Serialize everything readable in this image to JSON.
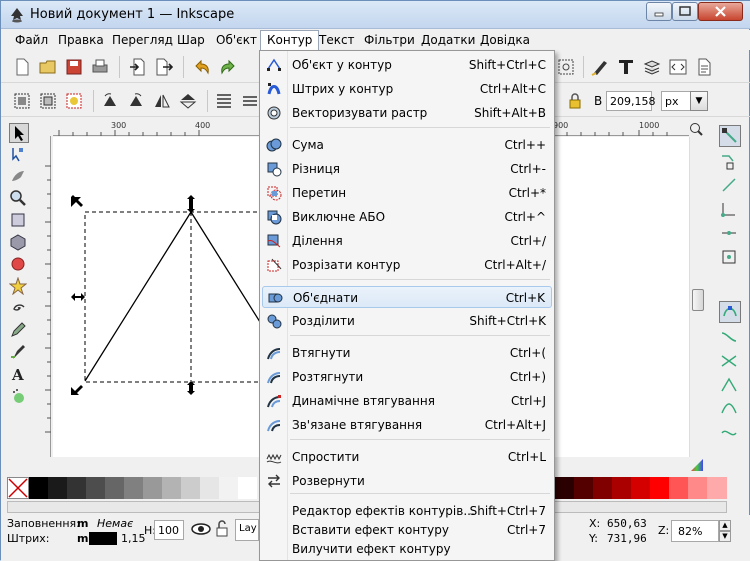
{
  "window": {
    "title": "Новий документ 1 — Inkscape"
  },
  "menubar": [
    {
      "label": "Файл"
    },
    {
      "label": "Правка"
    },
    {
      "label": "Перегляд"
    },
    {
      "label": "Шар"
    },
    {
      "label": "Об'єкт"
    },
    {
      "label": "Контур"
    },
    {
      "label": "Текст"
    },
    {
      "label": "Фільтри"
    },
    {
      "label": "Додатки"
    },
    {
      "label": "Довідка"
    }
  ],
  "toolbar2": {
    "w_label": "В",
    "w_value": "209,158",
    "unit": "px"
  },
  "ruler": {
    "h_labels": [
      "300",
      "400",
      "900",
      "1000"
    ]
  },
  "path_menu": {
    "items": [
      {
        "label": "Об'єкт у контур",
        "accel": "Shift+Ctrl+C",
        "icon": "object-to-path-icon"
      },
      {
        "label": "Штрих у контур",
        "accel": "Ctrl+Alt+C",
        "icon": "stroke-to-path-icon"
      },
      {
        "label": "Векторизувати растр",
        "accel": "Shift+Alt+B",
        "icon": "trace-bitmap-icon"
      },
      {
        "label": "Сума",
        "accel": "Ctrl++",
        "icon": "union-icon"
      },
      {
        "label": "Різниця",
        "accel": "Ctrl+-",
        "icon": "difference-icon"
      },
      {
        "label": "Перетин",
        "accel": "Ctrl+*",
        "icon": "intersection-icon"
      },
      {
        "label": "Виключне АБО",
        "accel": "Ctrl+^",
        "icon": "exclusion-icon"
      },
      {
        "label": "Ділення",
        "accel": "Ctrl+/",
        "icon": "division-icon"
      },
      {
        "label": "Розрізати контур",
        "accel": "Ctrl+Alt+/",
        "icon": "cut-path-icon"
      },
      {
        "label": "Об'єднати",
        "accel": "Ctrl+K",
        "icon": "combine-icon"
      },
      {
        "label": "Розділити",
        "accel": "Shift+Ctrl+K",
        "icon": "break-apart-icon"
      },
      {
        "label": "Втягнути",
        "accel": "Ctrl+(",
        "icon": "inset-icon"
      },
      {
        "label": "Розтягнути",
        "accel": "Ctrl+)",
        "icon": "outset-icon"
      },
      {
        "label": "Динамічне втягування",
        "accel": "Ctrl+J",
        "icon": "dynamic-offset-icon"
      },
      {
        "label": "Зв'язане втягування",
        "accel": "Ctrl+Alt+J",
        "icon": "linked-offset-icon"
      },
      {
        "label": "Спростити",
        "accel": "Ctrl+L",
        "icon": "simplify-icon"
      },
      {
        "label": "Розвернути",
        "accel": "",
        "icon": "reverse-icon"
      },
      {
        "label": "Редактор ефектів контурів...",
        "accel": "Shift+Ctrl+7",
        "icon": ""
      },
      {
        "label": "Вставити ефект контуру",
        "accel": "Ctrl+7",
        "icon": ""
      },
      {
        "label": "Вилучити ефект контуру",
        "accel": "",
        "icon": ""
      }
    ]
  },
  "status": {
    "fill_label": "Заповнення:",
    "fill_value_m": "m",
    "fill_value": "Немає",
    "stroke_label": "Штрих:",
    "stroke_value_m": "m",
    "stroke_width": "1,15",
    "opacity_label": "H:",
    "opacity_value": "100",
    "layer": "Lay",
    "x_label": "X:",
    "x_value": "650,63",
    "y_label": "Y:",
    "y_value": "731,96",
    "zoom_label": "Z:",
    "zoom_value": "82%"
  },
  "colors": {
    "menu_highlight": "#dce9f7",
    "accent": "#2a6ebb"
  }
}
